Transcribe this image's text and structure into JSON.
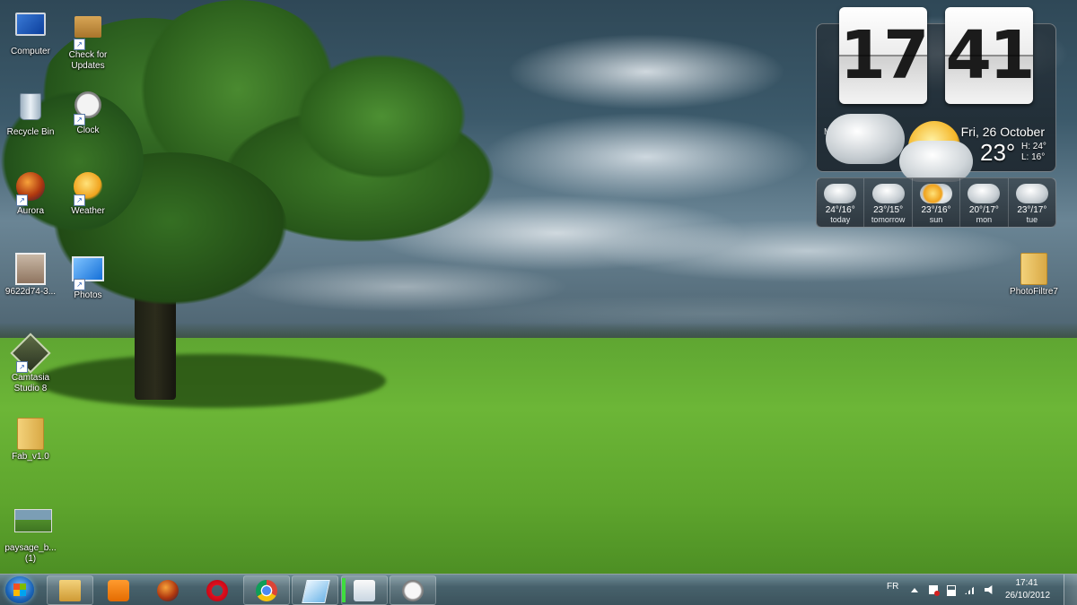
{
  "desktop": {
    "icons": [
      {
        "label": "Computer",
        "icon": "computer-icon"
      },
      {
        "label": "Check for Updates",
        "icon": "updates-box-icon"
      },
      {
        "label": "Recycle Bin",
        "icon": "recycle-bin-icon"
      },
      {
        "label": "Clock",
        "icon": "clock-icon"
      },
      {
        "label": "Aurora",
        "icon": "aurora-orb-icon"
      },
      {
        "label": "Weather",
        "icon": "weather-sun-icon"
      },
      {
        "label": "9622d74-3...",
        "icon": "photo-file-icon"
      },
      {
        "label": "Photos",
        "icon": "windows-photos-icon"
      },
      {
        "label": "Camtasia Studio 8",
        "icon": "camtasia-icon"
      },
      {
        "label": "Fab_v1.0",
        "icon": "folder-icon"
      },
      {
        "label": "paysage_b... (1)",
        "icon": "landscape-image-icon"
      },
      {
        "label": "PhotoFiltre7",
        "icon": "folder-icon"
      }
    ]
  },
  "gadget": {
    "hour": "17",
    "minute": "41",
    "city": "M...",
    "date": "Fri, 26 October",
    "temperature": "23°",
    "high": "H: 24°",
    "low": "L: 16°",
    "forecast": [
      {
        "temps": "24°/16°",
        "day": "today",
        "condition": "rain-cloud-icon"
      },
      {
        "temps": "23°/15°",
        "day": "tomorrow",
        "condition": "rain-cloud-icon"
      },
      {
        "temps": "23°/16°",
        "day": "sun",
        "condition": "sun-cloud-icon"
      },
      {
        "temps": "20°/17°",
        "day": "mon",
        "condition": "cloud-icon"
      },
      {
        "temps": "23°/17°",
        "day": "tue",
        "condition": "cloud-icon"
      }
    ]
  },
  "taskbar": {
    "pinned": [
      "start-orb",
      "windows-explorer",
      "media-player",
      "firefox",
      "opera",
      "chrome",
      "glass-app",
      "media-center",
      "clock-app"
    ],
    "language": "FR",
    "time": "17:41",
    "date": "26/10/2012"
  },
  "colors": {
    "taskbar": "#4b6672",
    "grass": "#6cb637",
    "sky": "#3c5a6b"
  }
}
